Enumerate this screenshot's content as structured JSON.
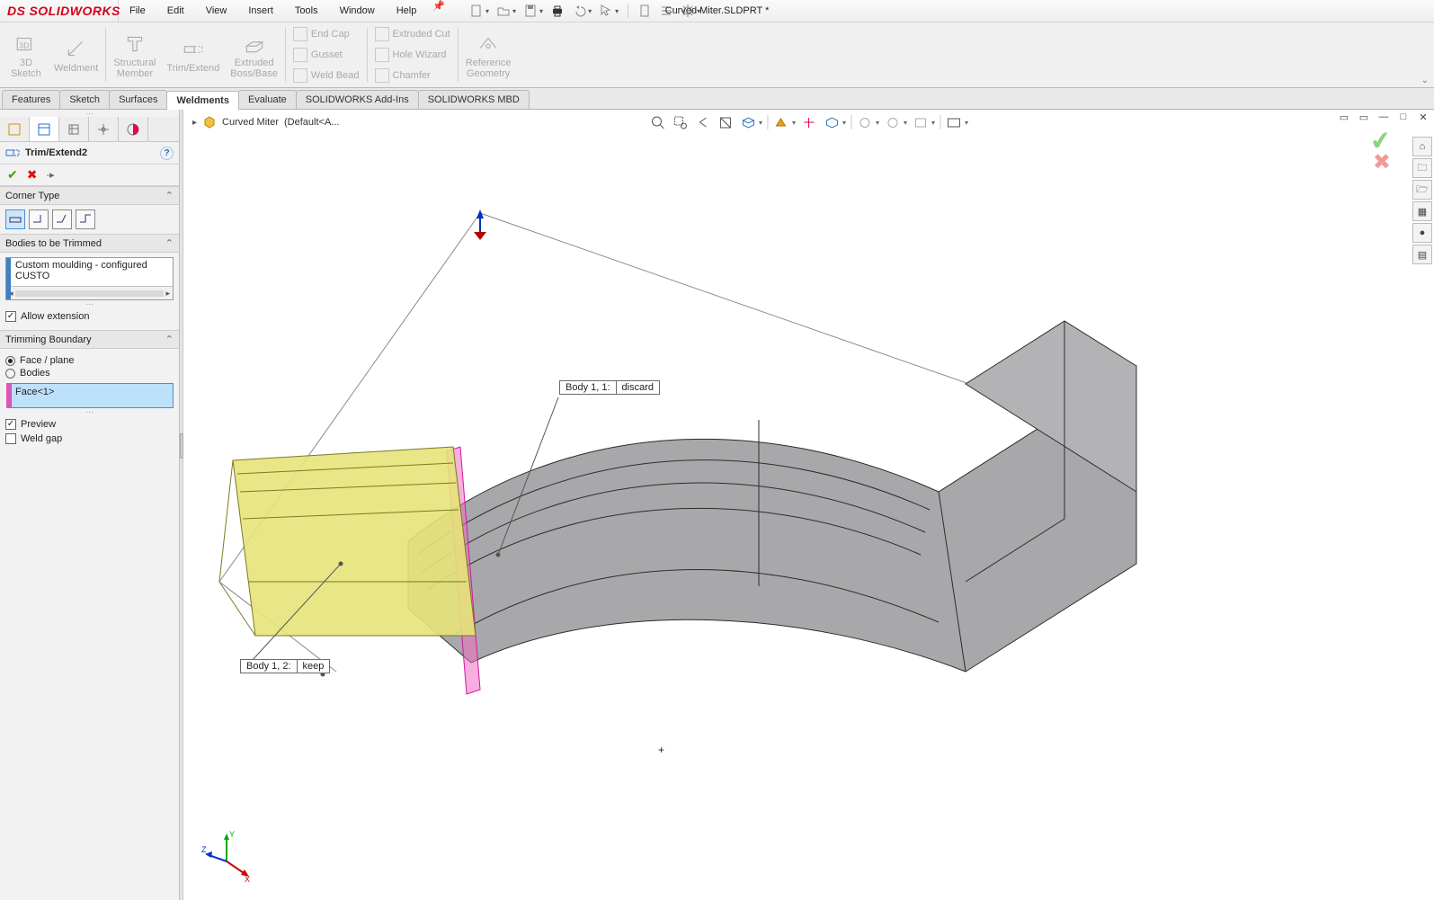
{
  "app": {
    "title": "Curved Miter.SLDPRT *",
    "logo": "SOLIDWORKS"
  },
  "menu": [
    "File",
    "Edit",
    "View",
    "Insert",
    "Tools",
    "Window",
    "Help"
  ],
  "ribbon": {
    "big": [
      {
        "id": "3d-sketch",
        "l1": "3D",
        "l2": "Sketch"
      },
      {
        "id": "weldment",
        "l1": "Weldment",
        "l2": ""
      },
      {
        "id": "structural-member",
        "l1": "Structural",
        "l2": "Member"
      },
      {
        "id": "trim-extend",
        "l1": "Trim/Extend",
        "l2": ""
      },
      {
        "id": "extruded-boss",
        "l1": "Extruded",
        "l2": "Boss/Base"
      }
    ],
    "stack1": [
      {
        "id": "end-cap",
        "label": "End Cap"
      },
      {
        "id": "gusset",
        "label": "Gusset"
      },
      {
        "id": "weld-bead",
        "label": "Weld Bead"
      }
    ],
    "stack2": [
      {
        "id": "extruded-cut",
        "label": "Extruded Cut"
      },
      {
        "id": "hole-wizard",
        "label": "Hole Wizard"
      },
      {
        "id": "chamfer",
        "label": "Chamfer"
      }
    ],
    "ref": {
      "id": "reference-geometry",
      "l1": "Reference",
      "l2": "Geometry"
    }
  },
  "feature_tabs": [
    "Features",
    "Sketch",
    "Surfaces",
    "Weldments",
    "Evaluate",
    "SOLIDWORKS Add-Ins",
    "SOLIDWORKS MBD"
  ],
  "feature_active": "Weldments",
  "pm": {
    "title": "Trim/Extend2",
    "sections": {
      "corner": {
        "header": "Corner Type"
      },
      "bodies": {
        "header": "Bodies to be Trimmed",
        "item": "Custom moulding - configured CUSTO",
        "allow": "Allow extension"
      },
      "boundary": {
        "header": "Trimming Boundary",
        "opt_face": "Face / plane",
        "opt_bodies": "Bodies",
        "selection": "Face<1>",
        "preview": "Preview",
        "weld_gap": "Weld gap"
      }
    }
  },
  "crumb": {
    "name": "Curved Miter",
    "state": "(Default<A..."
  },
  "callouts": {
    "discard": {
      "left": "Body  1,   1:",
      "right": "discard"
    },
    "keep": {
      "left": "Body  1,   2:",
      "right": "keep"
    }
  },
  "triad": {
    "x": "X",
    "y": "Y",
    "z": "Z"
  }
}
